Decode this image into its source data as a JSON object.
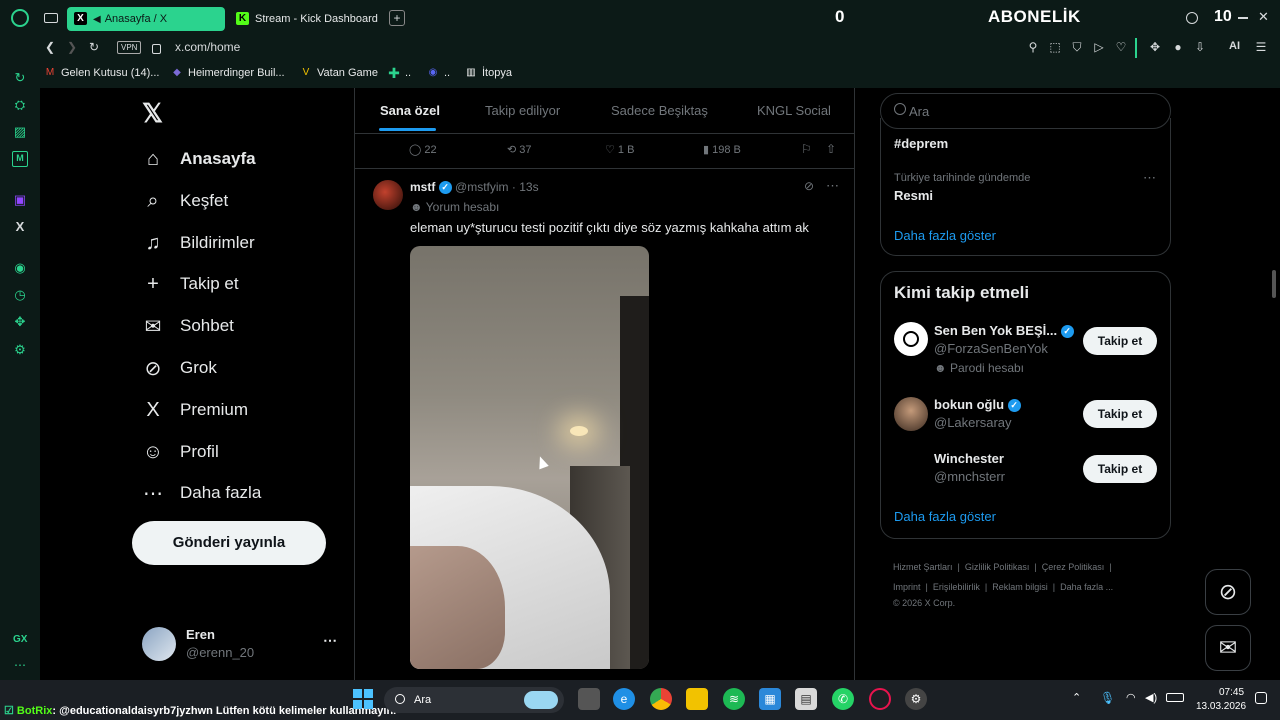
{
  "browser": {
    "tabs": [
      {
        "label": "Anasayfa / X",
        "icon": "x-logo-icon",
        "active": true
      },
      {
        "label": "Stream - Kick Dashboard",
        "icon": "kick-icon",
        "active": false
      }
    ],
    "new_tab_label": "+",
    "url": "x.com/home",
    "vpn_label": "VPN",
    "ai_label": "AI",
    "overlay_counter_left": "0",
    "overlay_title": "ABONELİK",
    "overlay_counter_right": "10",
    "bookmarks": [
      {
        "label": "Gelen Kutusu (14)...",
        "icon": "gmail-icon",
        "color": "#ea4335"
      },
      {
        "label": "Heimerdinger Buil...",
        "icon": "league-icon",
        "color": "#7b6ad6"
      },
      {
        "label": "Vatan Game",
        "icon": "vatan-icon",
        "color": "#f2c200"
      },
      {
        "label": "..",
        "icon": "plus-bookmark-icon",
        "color": "#2bd38e"
      },
      {
        "label": "..",
        "icon": "discord-icon",
        "color": "#5865f2"
      },
      {
        "label": "İtopya",
        "icon": "itopya-icon",
        "color": "#ffffff"
      }
    ]
  },
  "x": {
    "nav": [
      {
        "label": "Anasayfa",
        "icon": "home-icon",
        "glyph": "⌂",
        "active": true
      },
      {
        "label": "Keşfet",
        "icon": "search-icon",
        "glyph": "⌕"
      },
      {
        "label": "Bildirimler",
        "icon": "bell-icon",
        "glyph": "♫"
      },
      {
        "label": "Takip et",
        "icon": "follow-icon",
        "glyph": "+"
      },
      {
        "label": "Sohbet",
        "icon": "mail-icon",
        "glyph": "✉"
      },
      {
        "label": "Grok",
        "icon": "grok-icon",
        "glyph": "⊘"
      },
      {
        "label": "Premium",
        "icon": "x-premium-icon",
        "glyph": "X"
      },
      {
        "label": "Profil",
        "icon": "profile-icon",
        "glyph": "☺"
      },
      {
        "label": "Daha fazla",
        "icon": "more-circle-icon",
        "glyph": "⋯"
      }
    ],
    "post_button": "Gönderi yayınla",
    "account": {
      "name": "Eren",
      "handle": "@erenn_20"
    },
    "feed_tabs": [
      "Sana özel",
      "Takip ediliyor",
      "Sadece Beşiktaş",
      "KNGL Social"
    ],
    "prev_post_stats": {
      "replies": "22",
      "reposts": "37",
      "likes": "1 B",
      "views": "198 B"
    },
    "post": {
      "name": "mstf",
      "handle": "@mstfyim",
      "time": "· 13s",
      "label": "Yorum hesabı",
      "text": "eleman uy*şturucu testi pozitif çıktı diye söz yazmış kahkaha attım ak"
    },
    "search_placeholder": "Ara",
    "trends": [
      {
        "title": "#deprem"
      },
      {
        "context": "Türkiye tarihinde gündemde",
        "title": "Resmi"
      }
    ],
    "show_more": "Daha fazla göster",
    "who_to_follow": {
      "title": "Kimi takip etmeli",
      "users": [
        {
          "name": "Sen Ben Yok BEŞİ...",
          "handle": "@ForzaSenBenYok",
          "sub": "Parodi hesabı",
          "button": "Takip et"
        },
        {
          "name": "bokun oğlu",
          "handle": "@Lakersaray",
          "button": "Takip et"
        },
        {
          "name": "Winchester",
          "handle": "@mnchsterr",
          "button": "Takip et"
        }
      ],
      "show_more": "Daha fazla göster"
    },
    "footer": {
      "line1": [
        "Hizmet Şartları",
        "Gizlilik Politikası",
        "Çerez Politikası"
      ],
      "line2": [
        "Imprint",
        "Erişilebilirlik",
        "Reklam bilgisi",
        "Daha fazla ..."
      ],
      "copyright": "© 2026 X Corp."
    }
  },
  "taskbar": {
    "chat_user": "BotRix",
    "chat_message": ": @educationaldaisyrb7jyzhwn Lütfen kötü kelimeler kullanmayın.",
    "search_label": "Ara",
    "time": "07:45",
    "date": "13.03.2026"
  },
  "browser_sidebar_label": "GX",
  "colors": {
    "accent": "#1d9bf0",
    "opera_green": "#2bd38e",
    "background": "#000000"
  }
}
